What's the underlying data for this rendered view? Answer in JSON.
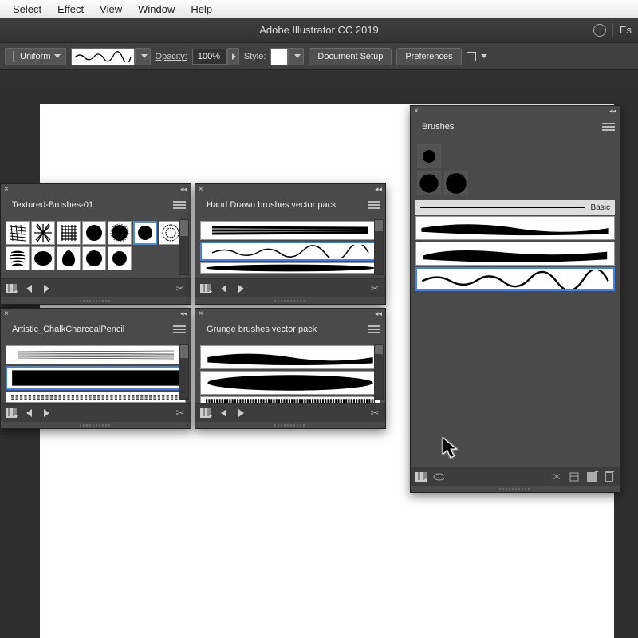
{
  "menubar": {
    "items": [
      "Select",
      "Effect",
      "View",
      "Window",
      "Help"
    ]
  },
  "title": "Adobe Illustrator CC 2019",
  "title_right": "Es",
  "ctrl": {
    "stroke_type": "Uniform",
    "opacity_label": "Opacity:",
    "opacity_value": "100%",
    "style_label": "Style:",
    "doc_setup": "Document Setup",
    "prefs": "Preferences"
  },
  "brushes_panel": {
    "tab": "Brushes",
    "basic_label": "Basic"
  },
  "p1": {
    "tab": "Textured-Brushes-01"
  },
  "p2": {
    "tab": "Hand Drawn brushes vector pack"
  },
  "p3": {
    "tab": "Artistic_ChalkCharcoalPencil"
  },
  "p4": {
    "tab": "Grunge brushes vector pack"
  }
}
